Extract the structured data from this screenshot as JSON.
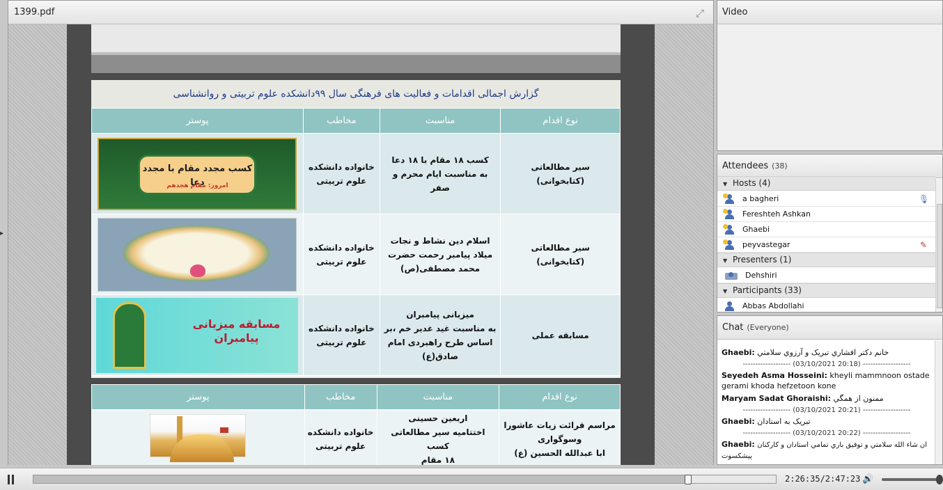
{
  "document_pod": {
    "title": "1399.pdf",
    "fullscreen_icon": "expand-icon",
    "slide1": {
      "title": "گزارش اجمالی اقدامات و فعالیت های فرهنگی سال ۹۹دانشکده  علوم تربیتی و روانشناسی",
      "headers": [
        "نوع اقدام",
        "مناسبت",
        "مخاطب",
        "پوستر"
      ],
      "rows": [
        {
          "type": "سیر مطالعاتی\n(کتابخوانی)",
          "occasion": "کسب ۱۸ مقام با ۱۸ دعا\nبه مناسبت ایام محرم و صفر",
          "audience": "خانواده دانشکده\nعلوم تربیتی",
          "poster_line1": "کسب مجدد مقام با مجدد دعا",
          "poster_line2": "امروز: مقام هجدهم"
        },
        {
          "type": "سیر مطالعاتی\n(کتابخوانی)",
          "occasion": "اسلام دین نشاط و نجات\nمیلاد پیامبر رحمت حضرت\nمحمد مصطفی(ص)",
          "audience": "خانواده دانشکده\nعلوم تربیتی"
        },
        {
          "type": "مسابقه عملی",
          "occasion": "میزبانی پیامبران\nبه مناسبت غید غدیر خم ،بر\nاساس طرح راهبردی امام\nصادق(ع)",
          "audience": "خانواده دانشکده\nعلوم تربیتی",
          "poster_title": "مسابقه میزبانی پیامبران"
        }
      ]
    },
    "slide2": {
      "headers": [
        "نوع اقدام",
        "مناسبت",
        "مخاطب",
        "پوستر"
      ],
      "row": {
        "type": "مراسم قرائت زیات عاشورا\nوسوگواری\nابا عبدالله الحسین (ع)",
        "occasion": "اربعین حسینی\nاختتامیه سیر مطالعاتی کسب\n۱۸ مقام",
        "audience": "خانواده دانشکده\nعلوم تربیتی"
      }
    }
  },
  "video_pod": {
    "title": "Video"
  },
  "attendees_pod": {
    "title": "Attendees",
    "count": "(38)",
    "hosts_label": "Hosts (4)",
    "hosts": [
      "a bagheri",
      "Fereshteh Ashkan",
      "Ghaebi",
      "peyvastegar"
    ],
    "presenters_label": "Presenters (1)",
    "presenters": [
      "Dehshiri"
    ],
    "participants_label": "Participants (33)",
    "participants": [
      "Abbas Abdollahi"
    ]
  },
  "chat_pod": {
    "title": "Chat",
    "scope": "(Everyone)",
    "messages": [
      {
        "who": "Ghaebi:",
        "text": "خانم دکتر افشاري تبريک و آرزوي سلامتي"
      },
      {
        "stamp": "------------------- (03/10/2021 20:18) -------------------"
      },
      {
        "who": "Seyedeh Asma Hosseini:",
        "text": "kheyli mammnoon ostade gerami khoda hefzetoon kone"
      },
      {
        "who": "Maryam Sadat Ghoraishi:",
        "text": "ممنون از همگي"
      },
      {
        "stamp": "------------------- (03/10/2021 20:21) -------------------"
      },
      {
        "who": "Ghaebi:",
        "text": "تبريک به استادان"
      },
      {
        "stamp": "------------------- (03/10/2021 20:22) -------------------"
      },
      {
        "who": "Ghaebi:",
        "text": "ان شاء الله سلامتي و توفيق باري تمامي استادان و کارکنان پيشکسوت"
      }
    ]
  },
  "playback": {
    "state_icon": "pause-icon",
    "progress": 0.882,
    "time": "2:26:35/2:47:23",
    "volume_icon": "speaker-icon",
    "volume": 0.95
  }
}
